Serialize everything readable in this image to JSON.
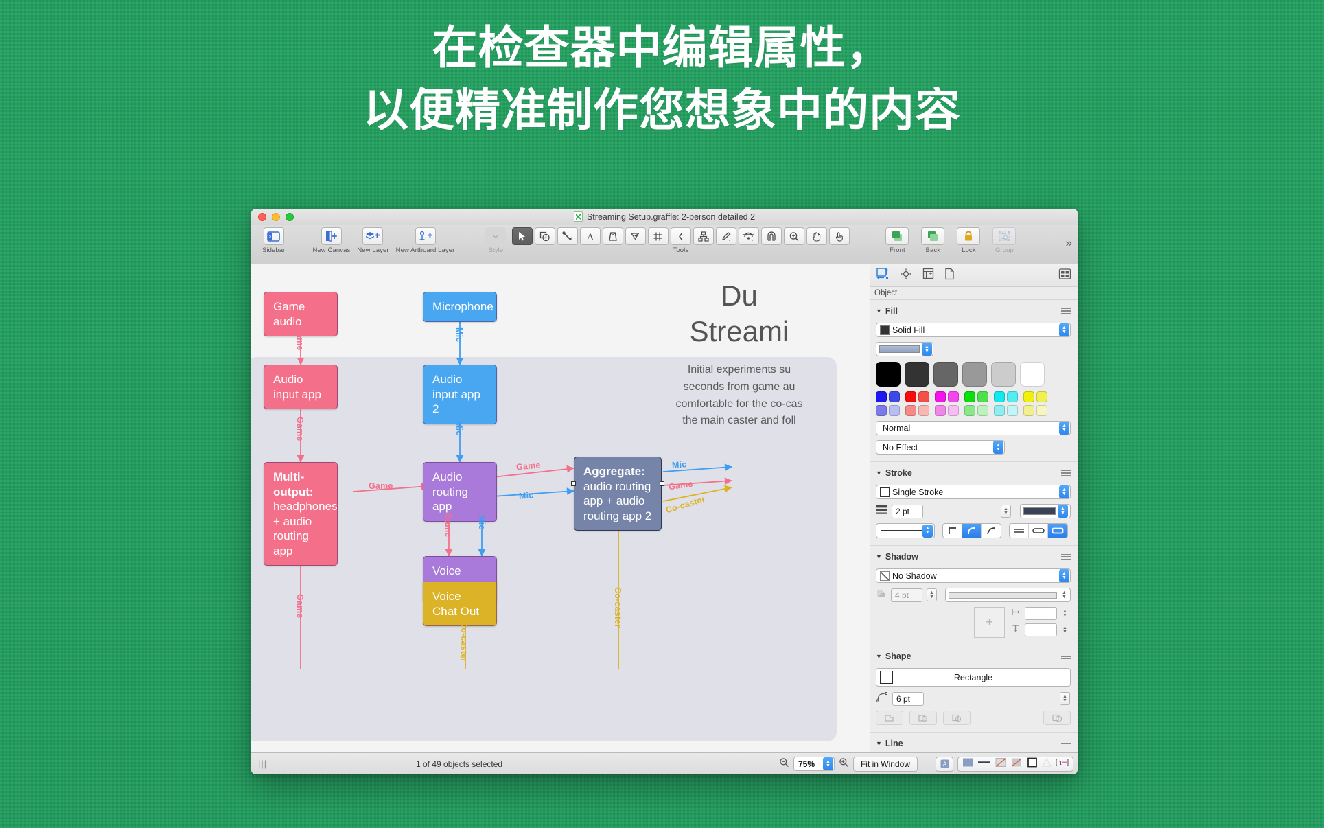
{
  "headline": {
    "line1": "在检查器中编辑属性，",
    "line2": "以便精准制作您想象中的内容"
  },
  "window": {
    "title": "Streaming Setup.graffle: 2-person detailed 2",
    "doc_icon": "omnigraffle-document-icon"
  },
  "toolbar": {
    "groups": [
      {
        "label": "Sidebar",
        "icon": "sidebar-icon"
      },
      {
        "label": "New Canvas",
        "icon": "new-canvas-icon"
      },
      {
        "label": "New Layer",
        "icon": "new-layer-icon"
      },
      {
        "label": "New Artboard Layer",
        "icon": "new-artboard-layer-icon"
      },
      {
        "label": "Style",
        "icon": "style-icon"
      },
      {
        "label": "Tools",
        "icon": "tools-group"
      },
      {
        "label": "Front",
        "icon": "bring-front-icon"
      },
      {
        "label": "Back",
        "icon": "send-back-icon"
      },
      {
        "label": "Lock",
        "icon": "lock-icon"
      },
      {
        "label": "Group",
        "icon": "group-icon"
      }
    ],
    "tools": [
      "selection-tool",
      "shape-tool",
      "line-tool",
      "text-tool",
      "pen-tool",
      "bezier-tool",
      "grid-tool",
      "angle-tool",
      "diagram-tool",
      "brush-tool",
      "magnet-tool",
      "snap-icon",
      "zoom-tool",
      "hand-tool",
      "browse-tool"
    ],
    "overflow": "»"
  },
  "canvas": {
    "text_block": {
      "line1": "Du",
      "line2": "Streami",
      "paragraph_lines": [
        "Initial experiments su",
        "seconds from game au",
        "comfortable for the co-cas",
        "the main caster and foll"
      ]
    },
    "nodes": [
      {
        "id": "game-audio",
        "label": "Game audio",
        "color": "#f4708a"
      },
      {
        "id": "microphone",
        "label": "Microphone",
        "color": "#49a7f2"
      },
      {
        "id": "audio-input-app",
        "label": "Audio input app",
        "color": "#f4708a"
      },
      {
        "id": "audio-input-app-2",
        "label": "Audio input app 2",
        "color": "#49a7f2"
      },
      {
        "id": "multi-output",
        "label_bold": "Multi-output:",
        "label": "headphones + audio routing app",
        "color": "#f4708a"
      },
      {
        "id": "audio-routing-app",
        "label": "Audio routing app",
        "color": "#a97ada"
      },
      {
        "id": "aggregate",
        "label_bold": "Aggregate:",
        "label": "audio routing app + audio routing app 2",
        "color": "#7584a8",
        "selected": true
      },
      {
        "id": "voice-chat-in",
        "label": "Voice Chat In",
        "color": "#a97ada"
      },
      {
        "id": "voice-chat-out",
        "label": "Voice Chat Out",
        "color": "#dcb226"
      }
    ],
    "edge_labels": [
      "Game",
      "Mic",
      "Game",
      "Mic",
      "Game",
      "Game",
      "Mic",
      "Game",
      "Mic",
      "Mic",
      "Game",
      "Co-caster",
      "Co-caster",
      "Co-caster",
      "Game"
    ],
    "colors": {
      "pink": "#f4708a",
      "blue": "#3f9ef2",
      "purple": "#a97ada",
      "gold": "#dcb226",
      "aggregate": "#7584a8",
      "artboard": "#e0e1e8"
    }
  },
  "inspector": {
    "tabs": [
      "object-inspector-icon",
      "properties-gear-icon",
      "canvas-inspector-icon",
      "document-inspector-icon"
    ],
    "grid_button": "inspector-grid-icon",
    "header": "Object",
    "fill": {
      "title": "Fill",
      "type": "Solid Fill",
      "blend": "Normal",
      "effect": "No Effect",
      "swatch_color": "#333333",
      "gradient_preview": "#8fa2c0",
      "palette_row_big": [
        "#000000",
        "#333333",
        "#666666",
        "#999999",
        "#cccccc",
        "#ffffff"
      ],
      "palette_row_mid": [
        "#1c18ef",
        "#3d49e8",
        "#f60c0c",
        "#f4504a",
        "#f413ed",
        "#f446ef",
        "#0ddc0d",
        "#4ce14c",
        "#12e8ef",
        "#52ecf2",
        "#f1ef0e",
        "#f2f04e"
      ],
      "palette_row_light": [
        "#7a7ae8",
        "#b9bef2",
        "#f58a86",
        "#f8b7b3",
        "#f285e9",
        "#f7bcf2",
        "#8ae88a",
        "#bdf2bd",
        "#8fedf2",
        "#c3f5f7",
        "#f2ef8f",
        "#f7f6c2"
      ]
    },
    "stroke": {
      "title": "Stroke",
      "type": "Single Stroke",
      "width": "2 pt",
      "color": "#3a4257",
      "dash": "solid-line",
      "corner_options": [
        "miter-corner-icon",
        "round-corner-icon",
        "bevel-corner-icon"
      ],
      "corner_selected": 1,
      "cap_options": [
        "flat-cap-icon",
        "round-cap-icon",
        "rect-cap-icon"
      ],
      "cap_selected": 2
    },
    "shadow": {
      "title": "Shadow",
      "type": "No Shadow",
      "blur": "4 pt",
      "offset_x": "",
      "offset_y": ""
    },
    "shape": {
      "title": "Shape",
      "name": "Rectangle",
      "corner_radius": "6 pt",
      "ops": [
        "union-icon",
        "subtract-icon",
        "intersect-icon",
        "combine-icon"
      ]
    },
    "line": {
      "title": "Line"
    }
  },
  "statusbar": {
    "grip": "|||",
    "selection": "1 of 49 objects selected",
    "zoom_out_icon": "zoom-out-icon",
    "zoom_value": "75%",
    "zoom_in_icon": "zoom-in-icon",
    "fit": "Fit in Window",
    "style_tray_icons": [
      "fill-swatch",
      "stroke-line",
      "shadow-none",
      "blur-none",
      "outline-square",
      "text-style"
    ]
  }
}
